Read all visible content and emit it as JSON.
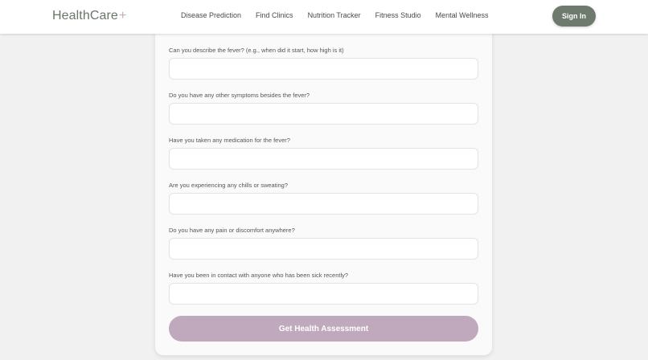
{
  "header": {
    "logo": "HealthCare",
    "logo_mark": "+",
    "nav": [
      "Disease Prediction",
      "Find Clinics",
      "Nutrition Tracker",
      "Fitness Studio",
      "Mental Wellness"
    ],
    "signin_label": "Sign In"
  },
  "form": {
    "questions": [
      {
        "label": "Can you describe the fever? (e.g., when did it start, how high is it)",
        "value": ""
      },
      {
        "label": "Do you have any other symptoms besides the fever?",
        "value": ""
      },
      {
        "label": "Have you taken any medication for the fever?",
        "value": ""
      },
      {
        "label": "Are you experiencing any chills or sweating?",
        "value": ""
      },
      {
        "label": "Do you have any pain or discomfort anywhere?",
        "value": ""
      },
      {
        "label": "Have you been in contact with anyone who has been sick recently?",
        "value": ""
      }
    ],
    "submit_label": "Get Health Assessment"
  },
  "colors": {
    "signin_bg": "#6e7a6e",
    "submit_bg": "#c0a9bc",
    "logo_text": "#6b756b",
    "logo_mark": "#c2aec0"
  }
}
